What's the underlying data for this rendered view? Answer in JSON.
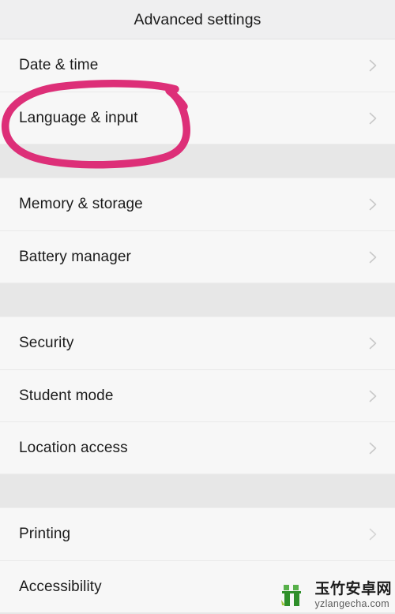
{
  "header": {
    "title": "Advanced settings"
  },
  "colors": {
    "screen_background": "#e7e7e7",
    "row_background": "#f7f7f7",
    "header_background": "#efeff0",
    "label_text": "#1b1b1b",
    "chevron": "#c9c9c9",
    "annotation_pink": "#dd2f78",
    "watermark_green": "#3f9b35"
  },
  "groups": [
    {
      "rows": [
        {
          "label": "Date & time",
          "chevron": "chevron-right-icon"
        },
        {
          "label": "Language & input",
          "chevron": "chevron-right-icon"
        }
      ]
    },
    {
      "rows": [
        {
          "label": "Memory & storage",
          "chevron": "chevron-right-icon"
        },
        {
          "label": "Battery manager",
          "chevron": "chevron-right-icon"
        }
      ]
    },
    {
      "rows": [
        {
          "label": "Security",
          "chevron": "chevron-right-icon"
        },
        {
          "label": "Student mode",
          "chevron": "chevron-right-icon"
        },
        {
          "label": "Location access",
          "chevron": "chevron-right-icon"
        }
      ]
    },
    {
      "rows": [
        {
          "label": "Printing",
          "chevron": "chevron-right-icon"
        },
        {
          "label": "Accessibility",
          "chevron": "chevron-right-icon"
        }
      ]
    }
  ],
  "annotation": {
    "shape": "hand-drawn-ellipse",
    "target_label": "Language & input",
    "color": "#dd2f78"
  },
  "watermark": {
    "brand_cn": "玉竹安卓网",
    "url": "yzlangecha.com",
    "logo": "yuzhu-logo-icon"
  }
}
